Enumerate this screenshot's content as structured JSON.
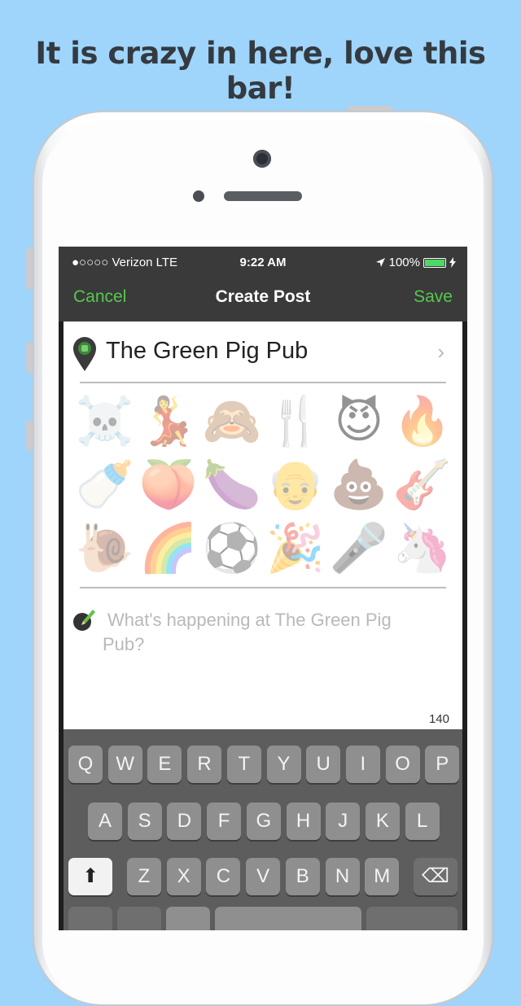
{
  "headline": "It is crazy in here, love this bar!",
  "status_bar": {
    "carrier": "●○○○○ Verizon  LTE",
    "time": "9:22 AM",
    "battery": "100%"
  },
  "nav": {
    "cancel_label": "Cancel",
    "title": "Create Post",
    "save_label": "Save"
  },
  "venue": {
    "name": "The Green Pig Pub",
    "chevron": "›"
  },
  "emojis": [
    "☠️",
    "💃",
    "🙈",
    "🍴",
    "😈",
    "🔥",
    "🍼",
    "🍑",
    "🍆",
    "👴",
    "💩",
    "🎸",
    "🐌",
    "🌈",
    "⚽",
    "🎉",
    "🎤",
    "🦄"
  ],
  "compose": {
    "placeholder_line1": "What's happening at The Green Pig",
    "placeholder_line2": "Pub?",
    "char_count": "140"
  },
  "keyboard": {
    "row1": [
      "Q",
      "W",
      "E",
      "R",
      "T",
      "Y",
      "U",
      "I",
      "O",
      "P"
    ],
    "row2": [
      "A",
      "S",
      "D",
      "F",
      "G",
      "H",
      "J",
      "K",
      "L"
    ],
    "row3": [
      "Z",
      "X",
      "C",
      "V",
      "B",
      "N",
      "M"
    ],
    "shift_glyph": "⬆",
    "delete_glyph": "⌫"
  }
}
